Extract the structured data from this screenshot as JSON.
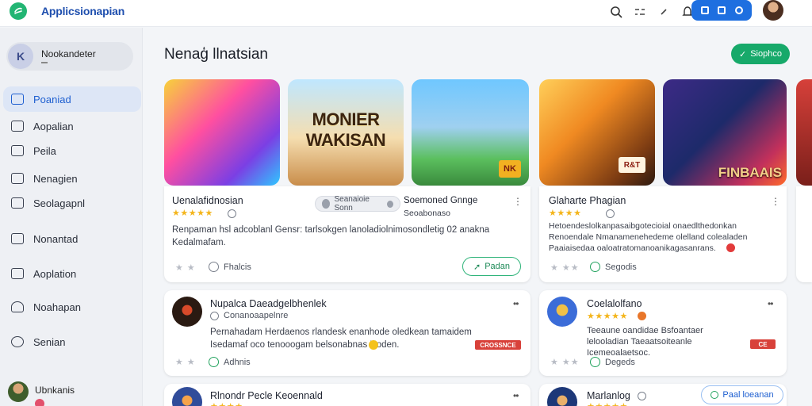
{
  "app": {
    "title": "Applicsionapian"
  },
  "sidebar": {
    "user_name": "Nookandeter",
    "user_initial": "K",
    "items": [
      {
        "label": "Poaniad",
        "active": true
      },
      {
        "label": "Aopalian"
      },
      {
        "label": "Peila"
      },
      {
        "label": "Nenagien"
      },
      {
        "label": "Seolagapnl"
      },
      {
        "label": "Nonantad"
      },
      {
        "label": "Aoplation"
      },
      {
        "label": "Noahapan"
      },
      {
        "label": "Senian"
      }
    ],
    "footer_user": "Ubnkanis"
  },
  "main": {
    "title": "Nenaģ llnatsian",
    "primary_button": "Siophco"
  },
  "thumbnails": {
    "t2_title": "MONIER WAKISAN",
    "t3_badge": "NK",
    "t4_badge": "R&T",
    "t5_title": "FINBAAIS"
  },
  "cards": [
    {
      "title": "Uenalafidnosian",
      "stars": "★★★★★",
      "pill_label": "Seanaioie Sonn",
      "secondary_title": "Soemoned Gnnge",
      "secondary_sub": "Seoabonaso",
      "desc": "Renpaman hsl adcoblanl Gensr: tarlsokgen lanoladiolnimosondletig 02 anakna Kedalmafam.",
      "grey_stars": "★ ★",
      "meta": "Fhalcis",
      "action": "Padan"
    },
    {
      "title": "Glaharte Phagian",
      "stars": "★★★★",
      "desc": "Hetoendeslolkanpasaibgotecioial onaedlthedonkan Renoendale Nmanamenehedeme olelland colealaden Paaiaisedaa oaloatratomanoanikagasanrans.",
      "grey_stars": "★ ★★",
      "meta": "Segodis"
    },
    {
      "title": "Nupalca Daeadgelbhenlek",
      "sub": "Conanoaapelnre",
      "desc": "Pernahadam Herdaenos rlandesk enanhode oledkean tamaidem Isedamaf oco tenooogam belsonabnas Hoden.",
      "badge": "CROSSNCE",
      "grey_stars": "★ ★",
      "meta": "Adhnis"
    },
    {
      "title": "Coelalolfano",
      "stars": "★★★★★",
      "desc": "Teeaune oandidae Bsfoantaer lelooladian Taeaatsoiteanle Icemeoalaetsoc.",
      "badge": "CE",
      "grey_stars": "★ ★★",
      "meta": "Degeds"
    },
    {
      "title": "Rlnondr Pecle Keoennald",
      "stars": "★★★★"
    },
    {
      "title": "Marlanlog",
      "stars": "★★★★★",
      "action": "Paal loeanan"
    }
  ]
}
